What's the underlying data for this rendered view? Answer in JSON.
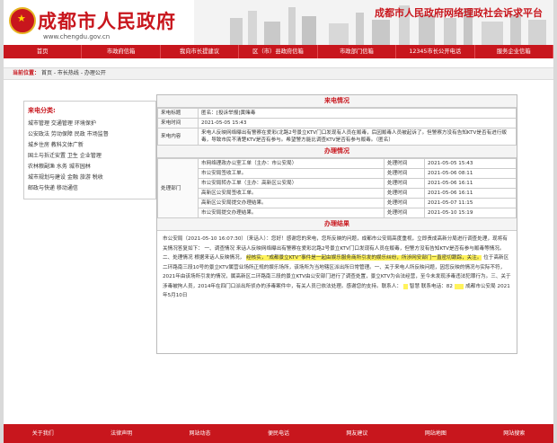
{
  "header": {
    "title": "成都市人民政府",
    "url": "www.chengdu.gov.cn",
    "platform": "成都市人民政府网络理政社会诉求平台"
  },
  "nav": [
    "首页",
    "市政府信箱",
    "我向市长提建议",
    "区（市）县政府信箱",
    "市政部门信箱",
    "12345市长公开电话",
    "服务企业信箱"
  ],
  "breadcrumb": {
    "label": "当前位置：",
    "path": "首页 - 市长热线 - 办理公开"
  },
  "sidebar": {
    "title": "来电分类:",
    "rows": [
      "城市管理  交通管理  环境保护",
      "公安政法  劳动保障  民政  市场监督",
      "城乡住房  教科文体广新",
      "国土与拆迁安置  卫生  企业管理",
      "农林粮副渔  水务  城市园林",
      "城市规划与建设  金融  旅游  税收",
      "邮政与快递  移动通信"
    ]
  },
  "call_info": {
    "section": "来电情况",
    "title_label": "来电标题",
    "title_value": "匿名：[投诉举报]黄赌毒",
    "time_label": "来电时间",
    "time_value": "2021-05-05 15:43",
    "content_label": "来电内容",
    "content_value": "来电人反映网络曝出有警察在爱彩(北路2号景立KTV门口发现有人员在贩毒，后因贩毒人员被起诉了。但警察方没有告知KTV是否有进行贩毒，导致市民不清楚KTV是否有参与。希望警方能比调查KTV是否有参与贩毒。（匿名）"
  },
  "handling": {
    "section": "办理情况",
    "dept_label": "处理部门",
    "time_label": "处理时间",
    "rows": [
      {
        "dept": "市网络理政办公室工单（主办：市公安局）",
        "time": "2021-05-05 15:43"
      },
      {
        "dept": "市公安局签收工单。",
        "time": "2021-05-06 08:11"
      },
      {
        "dept": "市公安局转办工单（主办：高新区公安局）",
        "time": "2021-05-06 16:11"
      },
      {
        "dept": "高新区公安局签收工单。",
        "time": "2021-05-06 16:11"
      },
      {
        "dept": "高新区公安局提交办理结果。",
        "time": "2021-05-07 11:15"
      },
      {
        "dept": "市公安局提交办理结果。",
        "time": "2021-05-10 15:19"
      }
    ]
  },
  "result": {
    "section": "办理结果",
    "p1": "市公安局（2021-05-10 16:07:30）（来话人）：您好！感谢您的来电，您所反映的问题，成都市公安局高度重视，立即责成高新分局进行调查处理，现将有关情况答复如下：",
    "p2": "一、调查情况  来话人反映网络曝出有警察在爱彩北路2号景立KTV门口发现有人员在贩毒，但警方没有告知KTV是否有参与贩毒等情况。二、处理情况  根据来话人反映情况，",
    "highlight": "经核实，“成都景立KTV”事件是一起由娱乐服务商所引发的娱乐纠纷，所涉网安部门一直密切跟踪，关注。",
    "p3": "位于高新区二环路南三段10号的景立KTV属营业场所正规的娱乐场所，该场所为当地辖区派出所日常管理。一、关于来电人所反映问题，因您反映的情况与实际不符，2021年由该场所引发的情况，属高新区二环路南三段的景立KTV由公安部门进行了调查处置，景立KTV为合法经营，至今未发现涉毒违法犯罪行为。三、关于涉毒被拘人员，2014年在四门口派出所侦办的涉毒案件中，有关人员已依法处理。感谢您的支持。联系人：",
    "contact_tail": "智慧  联系电话：82",
    "sign": "成都市公安局  2021年5月10日"
  },
  "footer": [
    "关于我们",
    "法律声明",
    "网站动态",
    "便民电话",
    "网友建议",
    "网站地图",
    "网站搜索"
  ]
}
